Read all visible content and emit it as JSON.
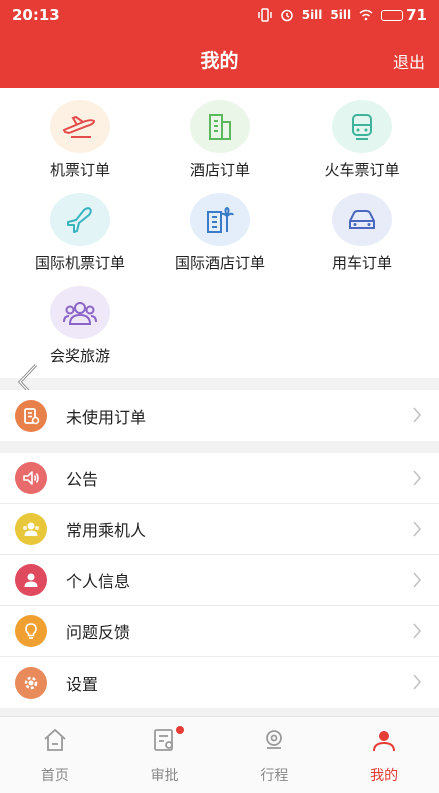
{
  "status": {
    "time": "20:13",
    "signal1": "5ill",
    "signal2": "5ill",
    "battery": "71"
  },
  "header": {
    "title": "我的",
    "logout": "退出"
  },
  "grid": [
    {
      "label": "机票订单",
      "icon": "plane-ticket-icon"
    },
    {
      "label": "酒店订单",
      "icon": "hotel-building-icon"
    },
    {
      "label": "火车票订单",
      "icon": "train-icon"
    },
    {
      "label": "国际机票订单",
      "icon": "international-plane-icon"
    },
    {
      "label": "国际酒店订单",
      "icon": "international-hotel-icon"
    },
    {
      "label": "用车订单",
      "icon": "car-icon"
    },
    {
      "label": "会奖旅游",
      "icon": "group-people-icon"
    }
  ],
  "menu_top": [
    {
      "label": "未使用订单",
      "icon": "unused-order-icon",
      "color": "#e8804a"
    }
  ],
  "menu": [
    {
      "label": "公告",
      "icon": "announcement-speaker-icon",
      "color": "#e86a6a"
    },
    {
      "label": "常用乘机人",
      "icon": "passengers-icon",
      "color": "#e8c83a"
    },
    {
      "label": "个人信息",
      "icon": "person-icon",
      "color": "#e04a5e"
    },
    {
      "label": "问题反馈",
      "icon": "feedback-bulb-icon",
      "color": "#f0a030"
    },
    {
      "label": "设置",
      "icon": "settings-gear-icon",
      "color": "#e88a5a"
    }
  ],
  "tabs": [
    {
      "label": "首页",
      "icon": "home-icon"
    },
    {
      "label": "审批",
      "icon": "approval-icon",
      "badge": true
    },
    {
      "label": "行程",
      "icon": "itinerary-location-icon"
    },
    {
      "label": "我的",
      "icon": "profile-icon",
      "active": true
    }
  ],
  "colors": {
    "brand": "#e63c35"
  }
}
